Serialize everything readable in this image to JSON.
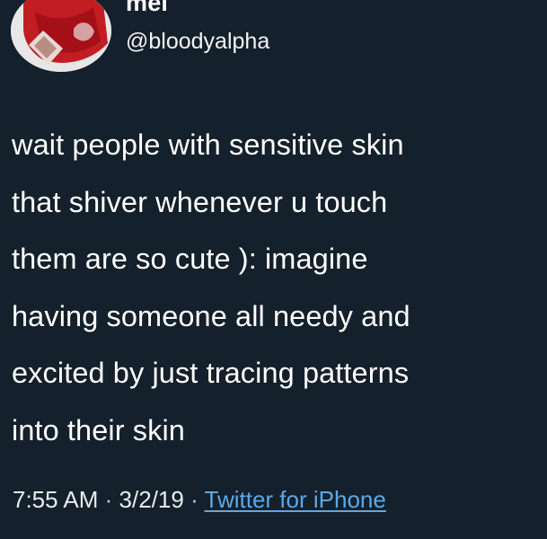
{
  "author": {
    "display_name": "mel",
    "handle": "@bloodyalpha"
  },
  "tweet": {
    "text": "wait people with sensitive skin\nthat shiver whenever u touch\nthem are so cute ): imagine\nhaving someone all needy and\nexcited by just tracing patterns\ninto their skin"
  },
  "meta": {
    "time": "7:55 AM",
    "separator": "·",
    "date": "3/2/19",
    "source": "Twitter for iPhone"
  },
  "colors": {
    "background": "#15202b",
    "text": "#ffffff",
    "link": "#5aa9ea"
  },
  "icons": {
    "avatar": "profile-photo"
  }
}
